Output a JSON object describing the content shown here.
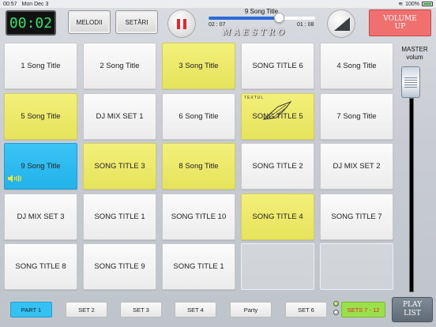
{
  "status": {
    "time": "00:57",
    "date": "Mon Dec 3",
    "battery": "100%"
  },
  "timer": "00:02",
  "buttons": {
    "melodii": "MELODII",
    "setari": "SETĂRI",
    "volume_up": "VOLUME\nUP",
    "playlist": "PLAY\nLIST"
  },
  "now_playing": {
    "title": "9 Song Title",
    "elapsed": "02 : 07",
    "remaining": "01 : 08",
    "progress": 0.66
  },
  "logo": "MAESTRO",
  "master": "MASTER\nvolum",
  "thumb_text": "TEXTUL",
  "cells": [
    {
      "label": "1 Song Title",
      "color": "white"
    },
    {
      "label": "2 Song Title",
      "color": "white"
    },
    {
      "label": "3 Song Title",
      "color": "yellow"
    },
    {
      "label": "SONG TITLE 6",
      "color": "white"
    },
    {
      "label": "4 Song Title",
      "color": "white"
    },
    {
      "label": "5 Song Title",
      "color": "yellow"
    },
    {
      "label": "DJ MIX SET 1",
      "color": "white"
    },
    {
      "label": "6 Song Title",
      "color": "white"
    },
    {
      "label": "SONG TITLE 5",
      "color": "yellow"
    },
    {
      "label": "7 Song Title",
      "color": "white"
    },
    {
      "label": "9 Song Title",
      "color": "blue"
    },
    {
      "label": "SONG TITLE 3",
      "color": "yellow"
    },
    {
      "label": "8 Song Title",
      "color": "yellow"
    },
    {
      "label": "SONG TITLE 2",
      "color": "white"
    },
    {
      "label": "DJ MIX SET 2",
      "color": "white"
    },
    {
      "label": "DJ MIX SET 3",
      "color": "white"
    },
    {
      "label": "SONG TITLE 1",
      "color": "white"
    },
    {
      "label": "SONG TITLE 10",
      "color": "white"
    },
    {
      "label": "SONG TITLE 4",
      "color": "yellow"
    },
    {
      "label": "SONG TITLE 7",
      "color": "white"
    },
    {
      "label": "SONG TITLE 8",
      "color": "white"
    },
    {
      "label": "SONG TITLE 9",
      "color": "white"
    },
    {
      "label": "SONG TITLE 1",
      "color": "white"
    },
    {
      "label": "",
      "color": "empty"
    },
    {
      "label": "",
      "color": "empty"
    }
  ],
  "sets": [
    "PART 1",
    "SET 2",
    "SET 3",
    "SET 4",
    "Party",
    "SET 6",
    "SETS 7 - 12"
  ],
  "colors": {
    "yellow": "#eceb6a",
    "blue": "#2fbaf0",
    "volume_up": "#f0706f",
    "timer_text": "#2ee46a"
  }
}
